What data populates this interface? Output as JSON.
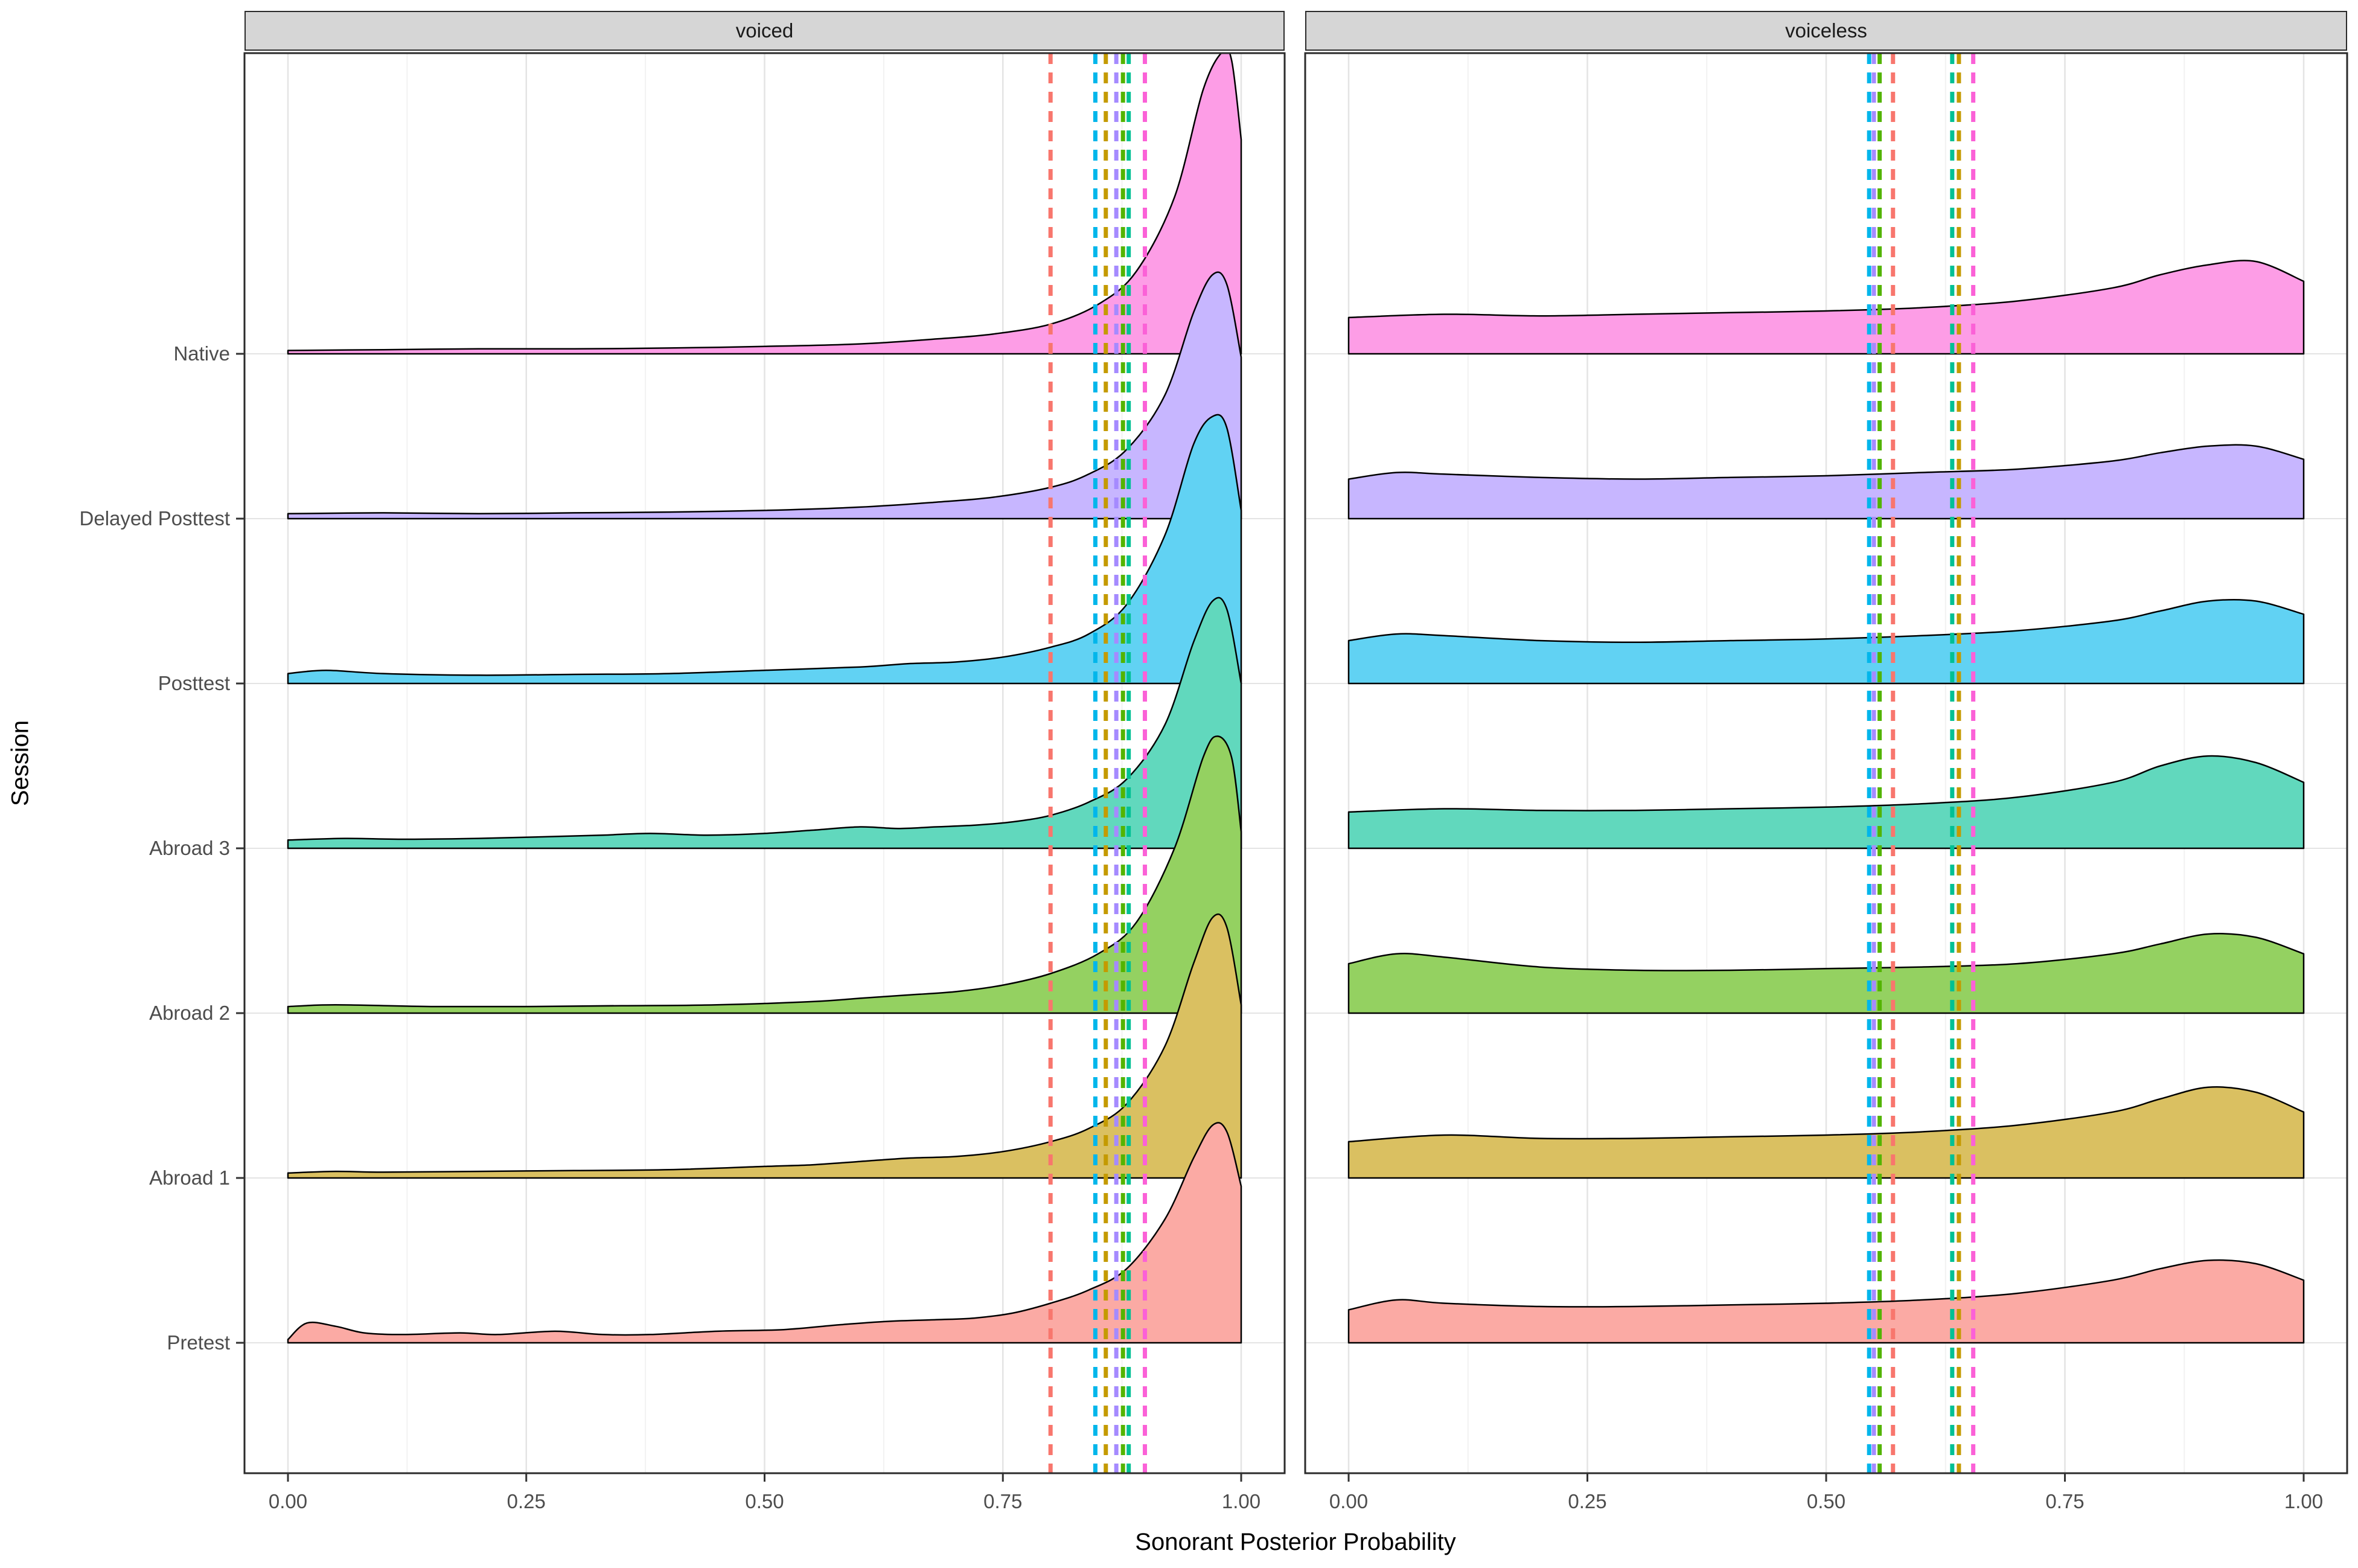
{
  "chart_data": {
    "type": "area",
    "subtype": "ridgeline-density-faceted",
    "title": "",
    "xlabel": "Sonorant Posterior Probability",
    "ylabel": "Session",
    "facets": [
      "voiced",
      "voiceless"
    ],
    "x_ticks": [
      0,
      0.25,
      0.5,
      0.75,
      1.0
    ],
    "x_tick_labels": [
      "0.00",
      "0.25",
      "0.50",
      "0.75",
      "1.00"
    ],
    "xlim": [
      0,
      1
    ],
    "grid": true,
    "legend": "none",
    "sessions_bottom_to_top": [
      {
        "label": "Pretest",
        "color": "#F8766D"
      },
      {
        "label": "Abroad 1",
        "color": "#C49A00"
      },
      {
        "label": "Abroad 2",
        "color": "#53B400"
      },
      {
        "label": "Abroad 3",
        "color": "#00C094"
      },
      {
        "label": "Posttest",
        "color": "#00B6EB"
      },
      {
        "label": "Delayed Posttest",
        "color": "#A58AFF"
      },
      {
        "label": "Native",
        "color": "#FB61D7"
      }
    ],
    "ridges": {
      "voiced": {
        "Pretest": [
          [
            0,
            0.02
          ],
          [
            0.02,
            0.12
          ],
          [
            0.05,
            0.1
          ],
          [
            0.08,
            0.06
          ],
          [
            0.12,
            0.05
          ],
          [
            0.18,
            0.06
          ],
          [
            0.22,
            0.05
          ],
          [
            0.28,
            0.07
          ],
          [
            0.33,
            0.05
          ],
          [
            0.38,
            0.05
          ],
          [
            0.45,
            0.07
          ],
          [
            0.52,
            0.08
          ],
          [
            0.58,
            0.11
          ],
          [
            0.63,
            0.13
          ],
          [
            0.68,
            0.14
          ],
          [
            0.72,
            0.15
          ],
          [
            0.76,
            0.18
          ],
          [
            0.8,
            0.24
          ],
          [
            0.84,
            0.32
          ],
          [
            0.88,
            0.45
          ],
          [
            0.92,
            0.75
          ],
          [
            0.95,
            1.12
          ],
          [
            0.97,
            1.32
          ],
          [
            0.985,
            1.28
          ],
          [
            1,
            0.95
          ]
        ],
        "Abroad 1": [
          [
            0,
            0.03
          ],
          [
            0.05,
            0.04
          ],
          [
            0.1,
            0.035
          ],
          [
            0.2,
            0.04
          ],
          [
            0.3,
            0.045
          ],
          [
            0.4,
            0.05
          ],
          [
            0.5,
            0.07
          ],
          [
            0.55,
            0.08
          ],
          [
            0.6,
            0.1
          ],
          [
            0.65,
            0.12
          ],
          [
            0.7,
            0.13
          ],
          [
            0.75,
            0.16
          ],
          [
            0.8,
            0.22
          ],
          [
            0.84,
            0.3
          ],
          [
            0.88,
            0.45
          ],
          [
            0.92,
            0.8
          ],
          [
            0.95,
            1.3
          ],
          [
            0.97,
            1.58
          ],
          [
            0.985,
            1.52
          ],
          [
            1,
            1.05
          ]
        ],
        "Abroad 2": [
          [
            0,
            0.04
          ],
          [
            0.05,
            0.05
          ],
          [
            0.15,
            0.04
          ],
          [
            0.25,
            0.04
          ],
          [
            0.35,
            0.045
          ],
          [
            0.45,
            0.05
          ],
          [
            0.55,
            0.07
          ],
          [
            0.6,
            0.09
          ],
          [
            0.65,
            0.11
          ],
          [
            0.7,
            0.13
          ],
          [
            0.75,
            0.17
          ],
          [
            0.8,
            0.24
          ],
          [
            0.85,
            0.36
          ],
          [
            0.89,
            0.55
          ],
          [
            0.93,
            1.0
          ],
          [
            0.96,
            1.55
          ],
          [
            0.975,
            1.68
          ],
          [
            0.99,
            1.55
          ],
          [
            1,
            1.1
          ]
        ],
        "Abroad 3": [
          [
            0,
            0.05
          ],
          [
            0.06,
            0.06
          ],
          [
            0.12,
            0.055
          ],
          [
            0.2,
            0.06
          ],
          [
            0.27,
            0.07
          ],
          [
            0.33,
            0.08
          ],
          [
            0.38,
            0.09
          ],
          [
            0.44,
            0.08
          ],
          [
            0.5,
            0.09
          ],
          [
            0.55,
            0.11
          ],
          [
            0.6,
            0.13
          ],
          [
            0.64,
            0.12
          ],
          [
            0.68,
            0.13
          ],
          [
            0.72,
            0.14
          ],
          [
            0.76,
            0.16
          ],
          [
            0.8,
            0.2
          ],
          [
            0.84,
            0.28
          ],
          [
            0.88,
            0.42
          ],
          [
            0.92,
            0.75
          ],
          [
            0.95,
            1.25
          ],
          [
            0.97,
            1.5
          ],
          [
            0.985,
            1.45
          ],
          [
            1,
            1.0
          ]
        ],
        "Posttest": [
          [
            0,
            0.06
          ],
          [
            0.04,
            0.08
          ],
          [
            0.1,
            0.06
          ],
          [
            0.2,
            0.05
          ],
          [
            0.3,
            0.055
          ],
          [
            0.4,
            0.06
          ],
          [
            0.5,
            0.08
          ],
          [
            0.6,
            0.1
          ],
          [
            0.65,
            0.12
          ],
          [
            0.7,
            0.13
          ],
          [
            0.75,
            0.16
          ],
          [
            0.8,
            0.22
          ],
          [
            0.84,
            0.3
          ],
          [
            0.88,
            0.48
          ],
          [
            0.92,
            0.9
          ],
          [
            0.95,
            1.45
          ],
          [
            0.97,
            1.62
          ],
          [
            0.985,
            1.55
          ],
          [
            1,
            1.05
          ]
        ],
        "Delayed Posttest": [
          [
            0,
            0.03
          ],
          [
            0.1,
            0.035
          ],
          [
            0.2,
            0.03
          ],
          [
            0.3,
            0.035
          ],
          [
            0.4,
            0.04
          ],
          [
            0.5,
            0.05
          ],
          [
            0.6,
            0.07
          ],
          [
            0.68,
            0.1
          ],
          [
            0.74,
            0.13
          ],
          [
            0.8,
            0.19
          ],
          [
            0.84,
            0.27
          ],
          [
            0.88,
            0.42
          ],
          [
            0.92,
            0.75
          ],
          [
            0.95,
            1.25
          ],
          [
            0.97,
            1.48
          ],
          [
            0.985,
            1.42
          ],
          [
            1,
            0.98
          ]
        ],
        "Native": [
          [
            0,
            0.02
          ],
          [
            0.1,
            0.025
          ],
          [
            0.2,
            0.03
          ],
          [
            0.3,
            0.03
          ],
          [
            0.4,
            0.035
          ],
          [
            0.5,
            0.045
          ],
          [
            0.6,
            0.06
          ],
          [
            0.68,
            0.09
          ],
          [
            0.74,
            0.12
          ],
          [
            0.8,
            0.18
          ],
          [
            0.85,
            0.3
          ],
          [
            0.89,
            0.5
          ],
          [
            0.93,
            0.95
          ],
          [
            0.96,
            1.6
          ],
          [
            0.98,
            1.83
          ],
          [
            0.99,
            1.78
          ],
          [
            1,
            1.3
          ]
        ]
      },
      "voiceless": {
        "Pretest": [
          [
            0,
            0.2
          ],
          [
            0.05,
            0.26
          ],
          [
            0.1,
            0.24
          ],
          [
            0.2,
            0.22
          ],
          [
            0.3,
            0.22
          ],
          [
            0.4,
            0.23
          ],
          [
            0.5,
            0.24
          ],
          [
            0.6,
            0.26
          ],
          [
            0.7,
            0.3
          ],
          [
            0.8,
            0.38
          ],
          [
            0.85,
            0.45
          ],
          [
            0.9,
            0.5
          ],
          [
            0.95,
            0.48
          ],
          [
            1,
            0.38
          ]
        ],
        "Abroad 1": [
          [
            0,
            0.22
          ],
          [
            0.1,
            0.26
          ],
          [
            0.2,
            0.24
          ],
          [
            0.3,
            0.24
          ],
          [
            0.4,
            0.25
          ],
          [
            0.5,
            0.26
          ],
          [
            0.6,
            0.28
          ],
          [
            0.7,
            0.32
          ],
          [
            0.8,
            0.4
          ],
          [
            0.85,
            0.48
          ],
          [
            0.9,
            0.55
          ],
          [
            0.95,
            0.52
          ],
          [
            1,
            0.4
          ]
        ],
        "Abroad 2": [
          [
            0,
            0.3
          ],
          [
            0.05,
            0.36
          ],
          [
            0.1,
            0.34
          ],
          [
            0.2,
            0.28
          ],
          [
            0.3,
            0.26
          ],
          [
            0.4,
            0.26
          ],
          [
            0.5,
            0.27
          ],
          [
            0.6,
            0.28
          ],
          [
            0.7,
            0.3
          ],
          [
            0.8,
            0.36
          ],
          [
            0.85,
            0.42
          ],
          [
            0.9,
            0.48
          ],
          [
            0.95,
            0.46
          ],
          [
            1,
            0.36
          ]
        ],
        "Abroad 3": [
          [
            0,
            0.22
          ],
          [
            0.1,
            0.24
          ],
          [
            0.2,
            0.23
          ],
          [
            0.3,
            0.23
          ],
          [
            0.4,
            0.24
          ],
          [
            0.5,
            0.25
          ],
          [
            0.6,
            0.27
          ],
          [
            0.7,
            0.31
          ],
          [
            0.8,
            0.4
          ],
          [
            0.85,
            0.5
          ],
          [
            0.9,
            0.56
          ],
          [
            0.95,
            0.52
          ],
          [
            1,
            0.4
          ]
        ],
        "Posttest": [
          [
            0,
            0.26
          ],
          [
            0.05,
            0.3
          ],
          [
            0.1,
            0.29
          ],
          [
            0.2,
            0.26
          ],
          [
            0.3,
            0.25
          ],
          [
            0.4,
            0.26
          ],
          [
            0.5,
            0.27
          ],
          [
            0.6,
            0.29
          ],
          [
            0.7,
            0.32
          ],
          [
            0.8,
            0.38
          ],
          [
            0.85,
            0.44
          ],
          [
            0.9,
            0.5
          ],
          [
            0.95,
            0.5
          ],
          [
            1,
            0.42
          ]
        ],
        "Delayed Posttest": [
          [
            0,
            0.24
          ],
          [
            0.05,
            0.28
          ],
          [
            0.1,
            0.27
          ],
          [
            0.2,
            0.25
          ],
          [
            0.3,
            0.24
          ],
          [
            0.4,
            0.25
          ],
          [
            0.5,
            0.26
          ],
          [
            0.6,
            0.28
          ],
          [
            0.7,
            0.3
          ],
          [
            0.8,
            0.35
          ],
          [
            0.85,
            0.4
          ],
          [
            0.9,
            0.44
          ],
          [
            0.95,
            0.44
          ],
          [
            1,
            0.36
          ]
        ],
        "Native": [
          [
            0,
            0.22
          ],
          [
            0.1,
            0.24
          ],
          [
            0.2,
            0.23
          ],
          [
            0.3,
            0.24
          ],
          [
            0.4,
            0.25
          ],
          [
            0.5,
            0.26
          ],
          [
            0.6,
            0.28
          ],
          [
            0.7,
            0.32
          ],
          [
            0.8,
            0.4
          ],
          [
            0.85,
            0.48
          ],
          [
            0.9,
            0.54
          ],
          [
            0.95,
            0.56
          ],
          [
            1,
            0.44
          ]
        ]
      }
    },
    "mean_vlines": {
      "voiced": [
        {
          "session": "Pretest",
          "x": 0.8
        },
        {
          "session": "Posttest",
          "x": 0.847
        },
        {
          "session": "Abroad 1",
          "x": 0.858
        },
        {
          "session": "Delayed Posttest",
          "x": 0.869
        },
        {
          "session": "Abroad 2",
          "x": 0.876
        },
        {
          "session": "Abroad 3",
          "x": 0.882
        },
        {
          "session": "Native",
          "x": 0.899
        }
      ],
      "voiceless": [
        {
          "session": "Posttest",
          "x": 0.545
        },
        {
          "session": "Delayed Posttest",
          "x": 0.55
        },
        {
          "session": "Abroad 2",
          "x": 0.556
        },
        {
          "session": "Pretest",
          "x": 0.57
        },
        {
          "session": "Abroad 3",
          "x": 0.632
        },
        {
          "session": "Abroad 1",
          "x": 0.639
        },
        {
          "session": "Native",
          "x": 0.654
        }
      ]
    },
    "style_colors": {
      "strip_bg": "#d6d6d6",
      "panel_border": "#2b2b2b",
      "grid_major": "#e4e4e4",
      "grid_minor": "#f2f2f2",
      "tick_label": "#4d4d4d",
      "curve_stroke": "#000000"
    }
  }
}
